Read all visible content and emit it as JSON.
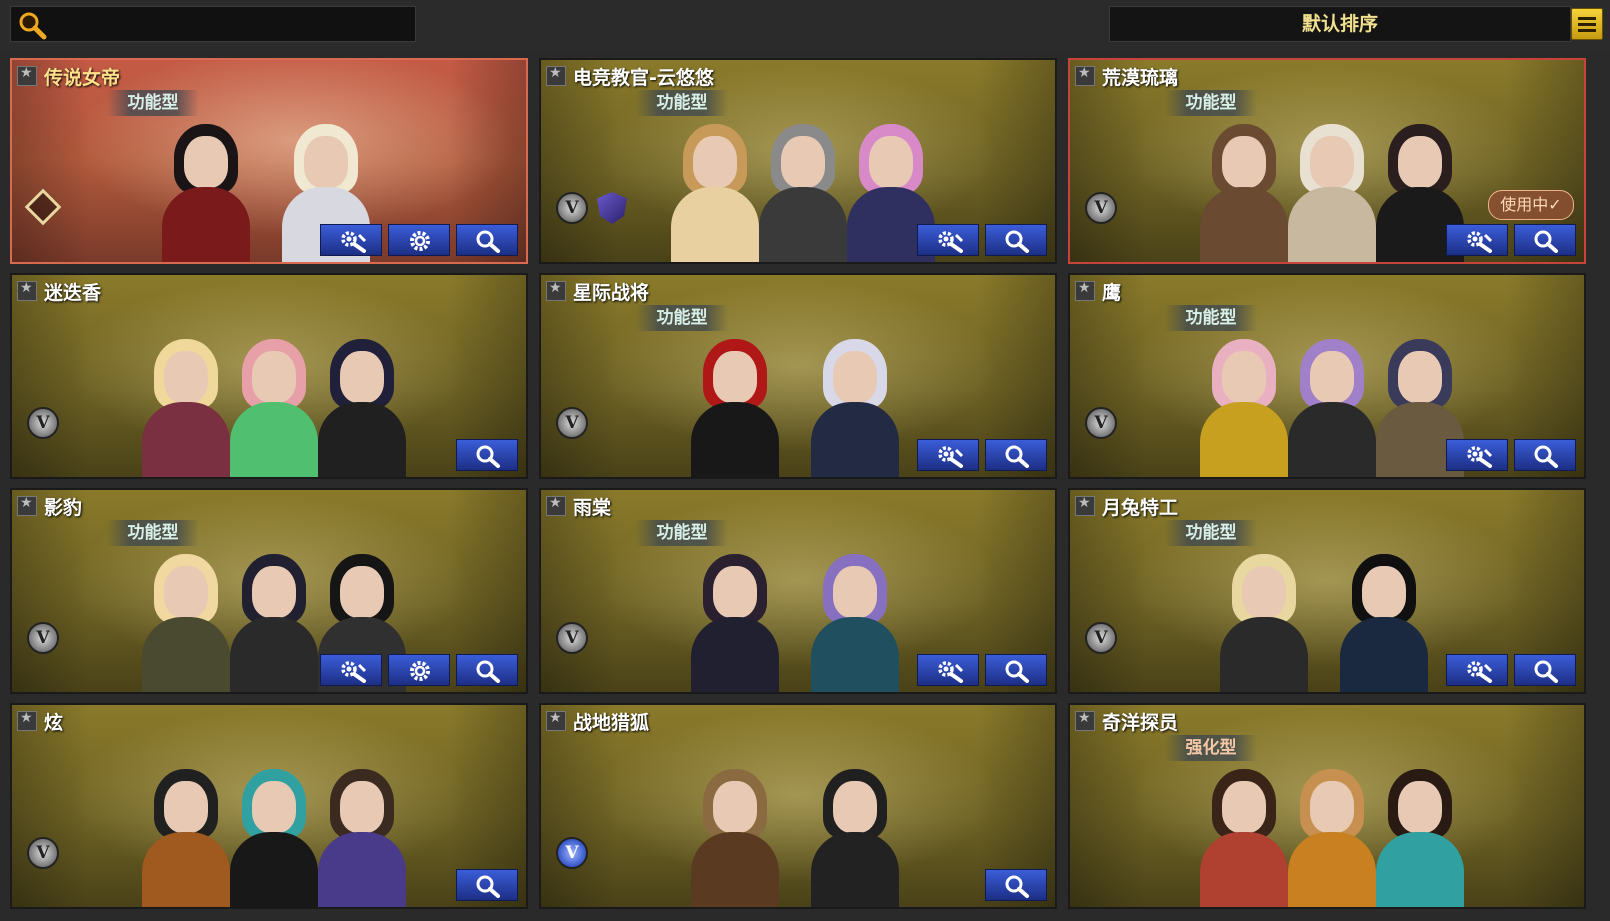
{
  "search": {
    "icon": "search-icon"
  },
  "sort": {
    "label": "默认排序"
  },
  "menu": {
    "icon": "menu-icon"
  },
  "cards": [
    {
      "title": "传说女帝",
      "tag": "功能型",
      "buttons": [
        "wrench-gear",
        "gear",
        "search"
      ],
      "badge": "diamond"
    },
    {
      "title": "电竞教官-云悠悠",
      "tag": "功能型",
      "buttons": [
        "wrench-gear",
        "search"
      ],
      "badge": "v"
    },
    {
      "title": "荒漠琉璃",
      "tag": "功能型",
      "buttons": [
        "wrench-gear",
        "search"
      ],
      "badge": "v",
      "status": "使用中✓"
    },
    {
      "title": "迷迭香",
      "tag": "",
      "buttons": [
        "search"
      ],
      "badge": "v"
    },
    {
      "title": "星际战将",
      "tag": "功能型",
      "buttons": [
        "wrench-gear",
        "search"
      ],
      "badge": "v"
    },
    {
      "title": "鹰",
      "tag": "功能型",
      "buttons": [
        "wrench-gear",
        "search"
      ],
      "badge": "v"
    },
    {
      "title": "影豹",
      "tag": "功能型",
      "buttons": [
        "wrench-gear",
        "gear",
        "search"
      ],
      "badge": "v"
    },
    {
      "title": "雨棠",
      "tag": "功能型",
      "buttons": [
        "wrench-gear",
        "search"
      ],
      "badge": "v"
    },
    {
      "title": "月兔特工",
      "tag": "功能型",
      "buttons": [
        "wrench-gear",
        "search"
      ],
      "badge": "v"
    },
    {
      "title": "炫",
      "tag": "",
      "buttons": [
        "search"
      ],
      "badge": "v"
    },
    {
      "title": "战地猎狐",
      "tag": "",
      "buttons": [
        "search"
      ],
      "badge": "v-blue"
    },
    {
      "title": "奇洋探员",
      "tag": "强化型",
      "buttons": [],
      "badge": ""
    }
  ]
}
